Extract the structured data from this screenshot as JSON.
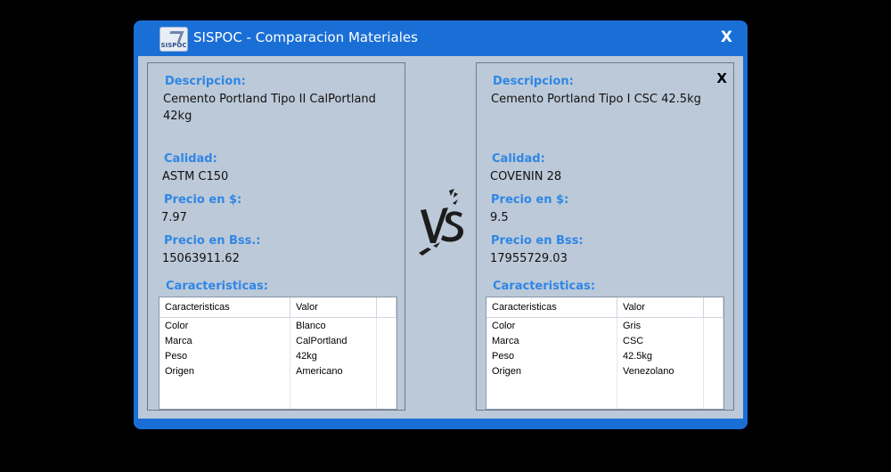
{
  "window": {
    "title": "SISPOC - Comparacion Materiales",
    "icon_label": "SISPOC",
    "close_label": "X"
  },
  "labels": {
    "descripcion": "Descripcion:",
    "calidad": "Calidad:",
    "precio_usd": "Precio en $:",
    "precio_bss_left": "Precio en Bss.:",
    "precio_bss_right": "Precio en Bss:",
    "caracteristicas": "Caracteristicas:"
  },
  "grid_headers": [
    "Caracteristicas",
    "Valor"
  ],
  "left": {
    "descripcion_line1": "Cemento Portland Tipo II CalPortland",
    "descripcion_line2": "42kg",
    "calidad": "ASTM C150",
    "precio_usd": "7.97",
    "precio_bss": "15063911.62",
    "rows": [
      [
        "Color",
        "Blanco"
      ],
      [
        "Marca",
        "CalPortland"
      ],
      [
        "Peso",
        "42kg"
      ],
      [
        "Origen",
        "Americano"
      ]
    ]
  },
  "right": {
    "close_label": "X",
    "descripcion_line1": "Cemento Portland Tipo I CSC 42.5kg",
    "calidad": "COVENIN 28",
    "precio_usd": "9.5",
    "precio_bss": "17955729.03",
    "rows": [
      [
        "Color",
        "Gris"
      ],
      [
        "Marca",
        "CSC"
      ],
      [
        "Peso",
        "42.5kg"
      ],
      [
        "Origen",
        "Venezolano"
      ]
    ]
  },
  "colors": {
    "titlebar": "#1a6fd6",
    "client_bg": "#bcc9d8",
    "label": "#2f86e6"
  },
  "icons": [
    "sispoc-logo-icon",
    "vs-graphic"
  ]
}
